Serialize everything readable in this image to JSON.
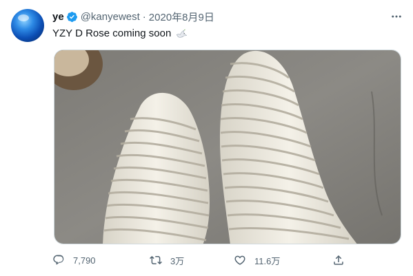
{
  "user": {
    "name": "ye",
    "handle": "@kanyewest",
    "date": "2020年8月9日",
    "separator": "·"
  },
  "tweet": {
    "text": "YZY D Rose coming soon",
    "emoji": "dove-emoji",
    "media": "photo-sneakers-yeezy"
  },
  "actions": {
    "replies": "7,790",
    "retweets": "3万",
    "likes": "11.6万"
  },
  "icons": {
    "verified": "verified-badge-icon",
    "more": "more-options-icon",
    "reply": "reply-icon",
    "retweet": "retweet-icon",
    "like": "heart-icon",
    "share": "share-icon"
  },
  "colors": {
    "brand": "#1d9bf0",
    "text": "#0f1419",
    "secondary": "#536471"
  }
}
